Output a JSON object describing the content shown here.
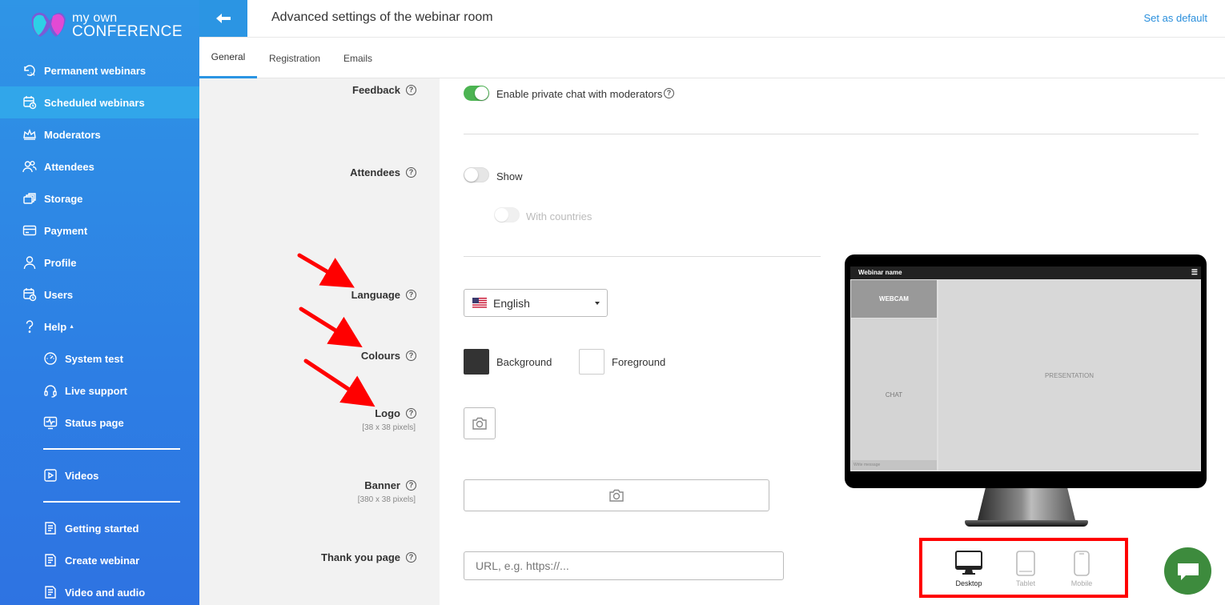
{
  "brand": {
    "line1": "my own",
    "line2": "CONFERENCE"
  },
  "header": {
    "title": "Advanced settings of the webinar room",
    "set_default": "Set as default"
  },
  "tabs": [
    {
      "label": "General",
      "active": true
    },
    {
      "label": "Registration",
      "active": false
    },
    {
      "label": "Emails",
      "active": false
    }
  ],
  "sidebar": {
    "items": [
      {
        "label": "Permanent webinars",
        "icon": "calendar-24-icon"
      },
      {
        "label": "Scheduled webinars",
        "icon": "calendar-clock-icon",
        "active": true
      },
      {
        "label": "Moderators",
        "icon": "crown-icon"
      },
      {
        "label": "Attendees",
        "icon": "people-icon"
      },
      {
        "label": "Storage",
        "icon": "folders-icon"
      },
      {
        "label": "Payment",
        "icon": "credit-card-icon"
      },
      {
        "label": "Profile",
        "icon": "user-icon"
      },
      {
        "label": "Users",
        "icon": "calendar-user-icon"
      },
      {
        "label": "Help",
        "icon": "question-icon",
        "expanded": true
      }
    ],
    "help_items": [
      {
        "label": "System test",
        "icon": "gauge-icon"
      },
      {
        "label": "Live support",
        "icon": "headset-icon"
      },
      {
        "label": "Status page",
        "icon": "pulse-monitor-icon"
      }
    ],
    "video_items": [
      {
        "label": "Videos",
        "icon": "play-icon"
      }
    ],
    "guide_items": [
      {
        "label": "Getting started",
        "icon": "book-icon"
      },
      {
        "label": "Create webinar",
        "icon": "book-icon"
      },
      {
        "label": "Video and audio",
        "icon": "book-icon"
      }
    ]
  },
  "form": {
    "feedback": {
      "label": "Feedback",
      "toggle_label": "Enable private chat with moderators",
      "enabled": true
    },
    "attendees": {
      "label": "Attendees",
      "show_label": "Show",
      "show": false,
      "countries_label": "With countries",
      "countries": false
    },
    "language": {
      "label": "Language",
      "value": "English"
    },
    "colours": {
      "label": "Colours",
      "background_label": "Background",
      "background": "#333333",
      "foreground_label": "Foreground",
      "foreground": "#ffffff"
    },
    "logo": {
      "label": "Logo",
      "hint": "[38 x 38 pixels]"
    },
    "banner": {
      "label": "Banner",
      "hint": "[380 x 38 pixels]"
    },
    "thank_you": {
      "label": "Thank you page",
      "placeholder": "URL, e.g. https://..."
    }
  },
  "preview": {
    "webinar_name": "Webinar name",
    "webcam": "WEBCAM",
    "chat": "CHAT",
    "presentation": "PRESENTATION",
    "message_placeholder": "Write message",
    "devices": [
      {
        "label": "Desktop",
        "active": true
      },
      {
        "label": "Tablet",
        "active": false
      },
      {
        "label": "Mobile",
        "active": false
      }
    ]
  },
  "colors": {
    "sidebar": "#2d7fe4",
    "accent": "#2b95e3",
    "toggle_on": "#4cb452",
    "highlight": "#ff0000",
    "chat_button": "#3d8b3d"
  }
}
